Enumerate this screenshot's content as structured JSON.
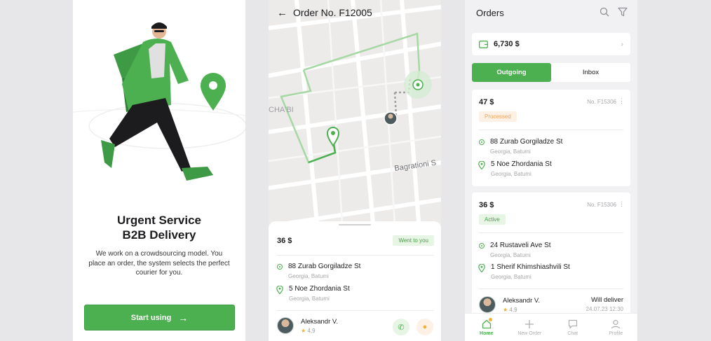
{
  "onboarding": {
    "title_line1": "Urgent Service",
    "title_line2": "B2B Delivery",
    "description": "We work on a crowdsourcing model. You place an order, the system selects the perfect courier for you.",
    "start_button": "Start using"
  },
  "order_detail": {
    "title": "Order No. F12005",
    "map_labels": {
      "left": "CHA'BI",
      "street": "Bagrationi S"
    },
    "price": "36 $",
    "status": "Went to you",
    "pickup": {
      "street": "88 Zurab Gorgiladze St",
      "city": "Georgia, Batumi"
    },
    "dropoff": {
      "street": "5 Noe Zhordania St",
      "city": "Georgia, Batumi"
    },
    "courier": {
      "name": "Aleksandr V.",
      "rating": "4,9"
    }
  },
  "orders": {
    "title": "Orders",
    "balance": "6,730 $",
    "tabs": {
      "outgoing": "Outgoing",
      "inbox": "Inbox"
    },
    "list": [
      {
        "price": "47 $",
        "number": "No. F15306",
        "status": "Processed",
        "pickup": {
          "street": "88 Zurab Gorgiladze St",
          "city": "Georgia, Batumi"
        },
        "dropoff": {
          "street": "5 Noe Zhordania St",
          "city": "Georgia, Batumi"
        }
      },
      {
        "price": "36 $",
        "number": "No. F15306",
        "status": "Active",
        "pickup": {
          "street": "24 Rustaveli Ave St",
          "city": "Georgia, Batumi"
        },
        "dropoff": {
          "street": "1 Sherif Khimshiashvili St",
          "city": "Georgia, Batumi"
        },
        "courier": {
          "name": "Aleksandr V.",
          "rating": "4,9"
        },
        "delivery_label": "Will deliver",
        "delivery_date": "24.07.23 12:30"
      }
    ],
    "tabbar": {
      "home": "Home",
      "new_order": "New Order",
      "chat": "Chat",
      "profile": "Profile"
    }
  },
  "colors": {
    "accent": "#4caf50",
    "processed": "#f0a35a",
    "star": "#f2b233"
  }
}
